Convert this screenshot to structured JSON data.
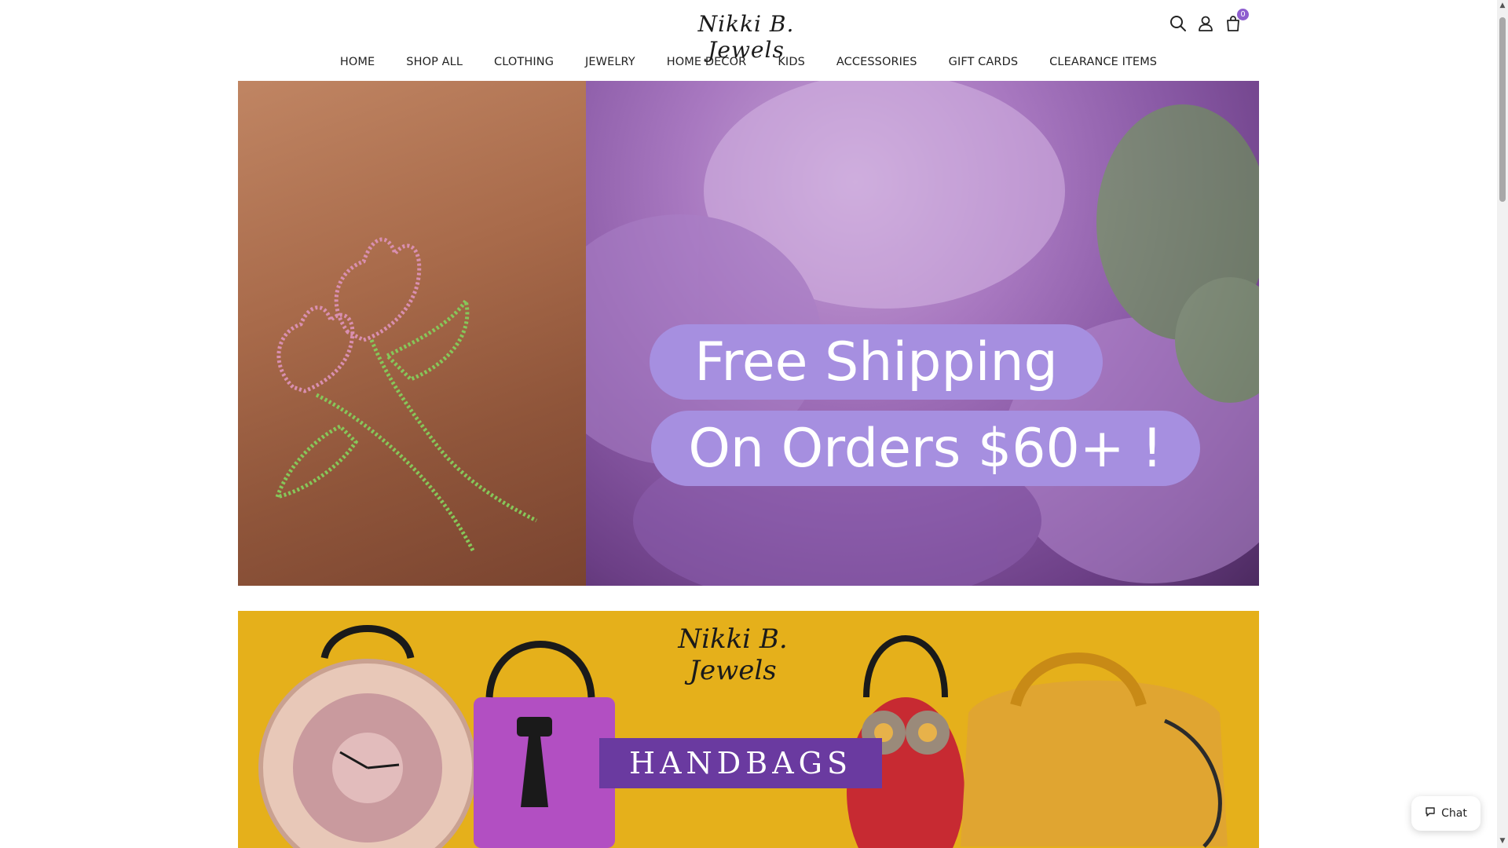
{
  "brand": {
    "logo_text": "Nikki B. Jewels"
  },
  "header": {
    "icons": [
      "search-icon",
      "user-icon",
      "cart-icon"
    ],
    "cart_count": "0",
    "accent_color": "#8e5ecf"
  },
  "nav": {
    "items": [
      "HOME",
      "SHOP ALL",
      "CLOTHING",
      "JEWELRY",
      "HOME DECOR",
      "KIDS",
      "ACCESSORIES",
      "GIFT CARDS",
      "CLEARANCE ITEMS"
    ]
  },
  "hero": {
    "line1": "Free Shipping",
    "line2": "On Orders $60+ !",
    "pill_color": "#a68fe0"
  },
  "banner": {
    "logo_text": "Nikki B. Jewels",
    "title": "HANDBAGS",
    "background_color": "#e5b01b",
    "band_color": "#6a3aa0"
  },
  "chat": {
    "label": "Chat"
  }
}
